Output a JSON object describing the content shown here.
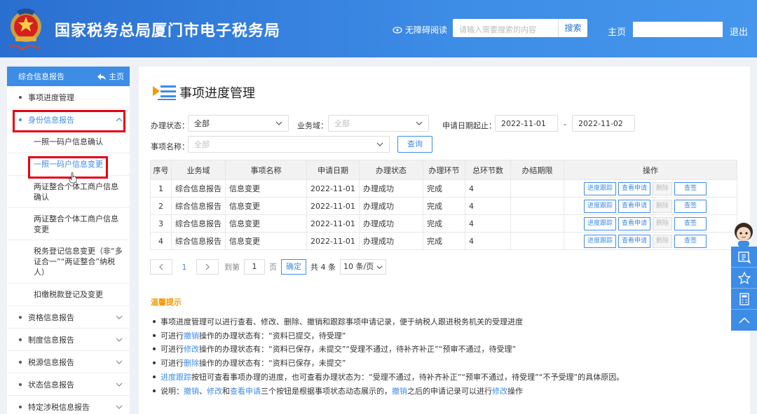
{
  "header": {
    "title": "国家税务总局厦门市电子税务局",
    "accessibility": "无障碍阅读",
    "search_placeholder": "请输入需要搜索的内容",
    "search_button": "搜索",
    "home": "主页",
    "logout": "退出"
  },
  "sidebar": {
    "title": "综合信息报告",
    "home": "主页",
    "items": [
      {
        "label": "事项进度管理"
      },
      {
        "label": "身份信息报告"
      },
      {
        "label": "资格信息报告"
      },
      {
        "label": "制度信息报告"
      },
      {
        "label": "税源信息报告"
      },
      {
        "label": "状态信息报告"
      },
      {
        "label": "特定涉税信息报告"
      }
    ],
    "subitems": [
      {
        "label": "一照一码户信息确认"
      },
      {
        "label": "一照一码户信息变更"
      },
      {
        "label": "两证整合个体工商户信息确认"
      },
      {
        "label": "两证整合个体工商户信息变更"
      },
      {
        "label": "税务登记信息变更（非“多证合一”“两证整合”纳税人）"
      },
      {
        "label": "扣缴税款登记及变更"
      }
    ]
  },
  "main": {
    "title": "事项进度管理",
    "filters": {
      "status_label": "办理状态：",
      "status_value": "全部",
      "domain_label": "业务域：",
      "domain_placeholder": "全部",
      "date_label": "申请日期起止：",
      "date_from": "2022-11-01",
      "date_sep": "-",
      "date_to": "2022-11-02",
      "name_label": "事项名称：",
      "name_placeholder": "全部",
      "query_button": "查询"
    },
    "table": {
      "headers": [
        "序号",
        "业务域",
        "事项名称",
        "申请日期",
        "办理状态",
        "办理环节",
        "总环节数",
        "办结期限",
        "操作"
      ],
      "rows": [
        [
          "1",
          "综合信息报告",
          "信息变更",
          "2022-11-01",
          "办理成功",
          "完成",
          "4",
          ""
        ],
        [
          "2",
          "综合信息报告",
          "信息变更",
          "2022-11-01",
          "办理成功",
          "完成",
          "4",
          ""
        ],
        [
          "3",
          "综合信息报告",
          "信息变更",
          "2022-11-01",
          "办理成功",
          "完成",
          "4",
          ""
        ],
        [
          "4",
          "综合信息报告",
          "信息变更",
          "2022-11-01",
          "办理成功",
          "完成",
          "4",
          ""
        ]
      ],
      "actions": {
        "track": "进度跟踪",
        "view": "查看申请",
        "delete": "删除",
        "sign": "查签"
      }
    },
    "pager": {
      "current": "1",
      "goto_prefix": "到第",
      "goto_value": "1",
      "goto_suffix": "页",
      "confirm": "确定",
      "total": "共 4 条",
      "page_size": "10 条/页"
    },
    "tips": {
      "title": "温馨提示",
      "lines": [
        "事项进度管理可以进行查看、修改、删除、撤销和跟踪事项申请记录，便于纳税人跟进税务机关的受理进度",
        "可进行撤销操作的办理状态有：“资料已提交，待受理”",
        "可进行修改操作的办理状态有：“资料已保存，未提交”“受理不通过，待补齐补正”“预审不通过，待受理”",
        "可进行删除操作的办理状态有：“资料已保存，未提交”",
        "进度跟踪按钮可查看事项办理的进度，也可查看办理状态为：“受理不通过，待补齐补正”“预审不通过，待受理”“不予受理”的具体原因。",
        "说明：撤销、修改和查看申请三个按钮是根据事项状态动态展示的，撤销之后的申请记录可以进行修改操作"
      ],
      "line2": {
        "pre": "可进行",
        "hl": "撤销",
        "post": "操作的办理状态有：“资料已提交，待受理”"
      },
      "line3": {
        "pre": "可进行",
        "hl": "修改",
        "post": "操作的办理状态有：“资料已保存，未提交”“受理不通过，待补齐补正”“预审不通过，待受理”"
      },
      "line4": {
        "pre": "可进行",
        "hl": "删除",
        "post": "操作的办理状态有：“资料已保存，未提交”"
      },
      "line5": {
        "hl": "进度跟踪",
        "post": "按钮可查看事项办理的进度，也可查看办理状态为：“受理不通过，待补齐补正”“预审不通过，待受理”“不予受理”的具体原因。"
      },
      "line6": {
        "pre": "说明：",
        "h1": "撤销",
        "s1": "、",
        "h2": "修改",
        "s2": "和",
        "h3": "查看申请",
        "s3": "三个按钮是根据事项状态动态展示的，",
        "h4": "撤销",
        "s4": "之后的申请记录可以进行",
        "h5": "修改",
        "s5": "操作"
      }
    }
  },
  "colors": {
    "brand": "#3d8ce6",
    "highlight_box": "#e60012",
    "tips_title": "#f39800"
  }
}
